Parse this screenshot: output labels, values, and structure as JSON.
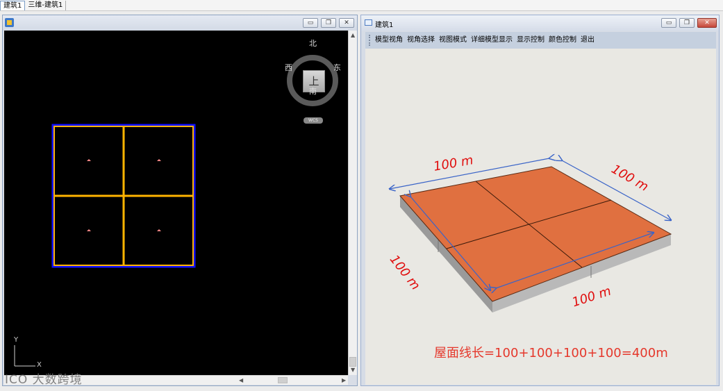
{
  "doc_tabs": [
    {
      "label": "建筑1",
      "active": true
    },
    {
      "label": "三维-建筑1",
      "active": false
    }
  ],
  "cad_view": {
    "compass": {
      "north": "北",
      "south": "南",
      "east": "东",
      "west": "西",
      "cube_face": "上"
    },
    "wcs_label": "WCS",
    "ucs": {
      "y": "Y",
      "x": "X"
    },
    "watermark": "ICO 大数跨境",
    "colors": {
      "background": "#000000",
      "boundary": "#1010ff",
      "grid_lines": "#ffb400"
    }
  },
  "view3d": {
    "title": "建筑1",
    "menu": [
      "模型视角",
      "视角选择",
      "视图模式",
      "详细模型显示",
      "显示控制",
      "颜色控制",
      "退出"
    ],
    "dimensions": [
      "100 m",
      "100 m",
      "100 m",
      "100 m"
    ],
    "formula": "屋面线长=100+100+100+100=400m",
    "colors": {
      "roof": "#e07040",
      "annotation": "#e00d0d",
      "dimension_line": "#3a64c8"
    }
  },
  "window_buttons": {
    "minimize": "▭",
    "restore": "❐",
    "close": "✕"
  }
}
